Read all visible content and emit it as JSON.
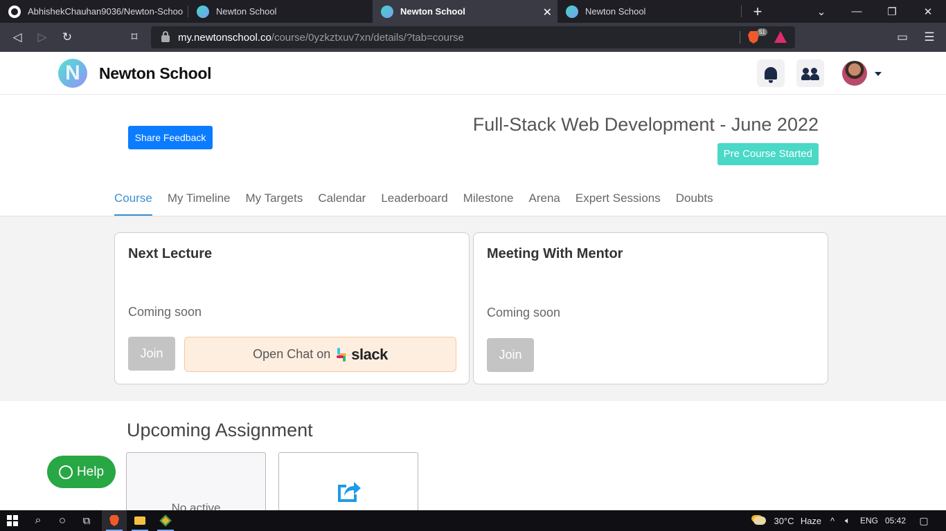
{
  "browser": {
    "tabs": [
      {
        "title": "AbhishekChauhan9036/Newton-Schoo",
        "active": false,
        "favicon": "github-icon"
      },
      {
        "title": "Newton School",
        "active": false,
        "favicon": "newton-icon"
      },
      {
        "title": "Newton School",
        "active": true,
        "favicon": "newton-icon"
      },
      {
        "title": "Newton School",
        "active": false,
        "favicon": "newton-icon"
      }
    ],
    "url_host": "my.newtonschool.co",
    "url_path": "/course/0yzkztxuv7xn/details/?tab=course",
    "brave_shield_count": "51"
  },
  "site": {
    "brand": "Newton School",
    "logo_letter": "N"
  },
  "course": {
    "share_feedback_label": "Share Feedback",
    "title": "Full-Stack Web Development - June 2022",
    "status": "Pre Course Started",
    "tabs": [
      "Course",
      "My Timeline",
      "My Targets",
      "Calendar",
      "Leaderboard",
      "Milestone",
      "Arena",
      "Expert Sessions",
      "Doubts"
    ],
    "active_tab": "Course"
  },
  "cards": {
    "next_lecture": {
      "title": "Next Lecture",
      "status": "Coming soon",
      "join_label": "Join",
      "chat_prefix": "Open Chat on",
      "chat_brand": "slack"
    },
    "mentor": {
      "title": "Meeting With Mentor",
      "status": "Coming soon",
      "join_label": "Join"
    }
  },
  "assignments": {
    "title": "Upcoming Assignment",
    "empty_text": "No active"
  },
  "help": {
    "label": "Help"
  },
  "taskbar": {
    "weather": "30°C",
    "weather_desc": "Haze",
    "lang": "ENG",
    "time": "05:42"
  },
  "colors": {
    "primary": "#0b7cff",
    "badge": "#4ad8c7",
    "tab_active": "#3a8fd0",
    "help": "#28a745",
    "slack_bg": "#fdeee0"
  }
}
